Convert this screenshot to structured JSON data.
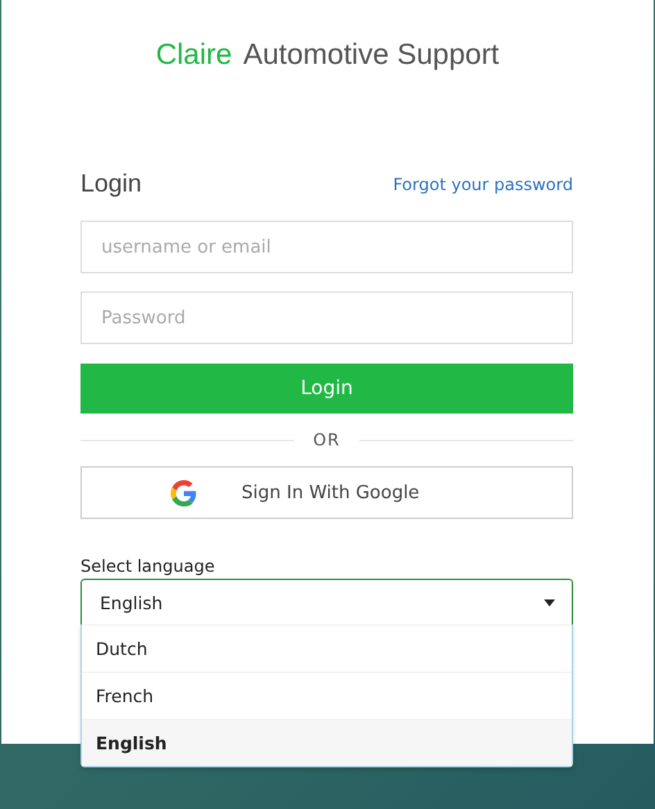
{
  "brand": {
    "name": "Claire",
    "subtitle": "Automotive Support"
  },
  "login": {
    "heading": "Login",
    "forgot_link": "Forgot your password"
  },
  "fields": [
    {
      "placeholder": "username or email"
    },
    {
      "placeholder": "Password"
    }
  ],
  "login_button": "Login",
  "divider": "OR",
  "google_button": "Sign In With Google",
  "language": {
    "label": "Select language",
    "value": "English",
    "expanded": true,
    "options": [
      {
        "label": "Dutch",
        "selected": false
      },
      {
        "label": "French",
        "selected": false
      },
      {
        "label": "English",
        "selected": true
      }
    ]
  }
}
